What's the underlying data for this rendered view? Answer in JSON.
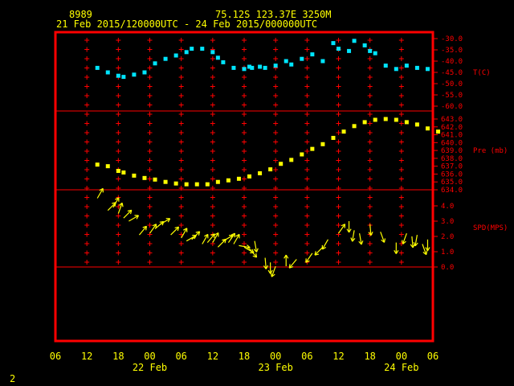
{
  "header": {
    "station_id": "8989",
    "location": "75.12S   123.37E   3250M",
    "time_range": "21 Feb 2015/120000UTC - 24 Feb 2015/000000UTC"
  },
  "footer": {
    "page_number": "2"
  },
  "colors": {
    "frame": "#ff0000",
    "grid": "#ff0000",
    "text": "#ffff00",
    "temperature": "#00e5ff",
    "pressure": "#ffff00",
    "wind": "#ffff00"
  },
  "chart_data": [
    {
      "type": "scatter",
      "panel": "temperature",
      "ylabel": "T(C)",
      "ylim": [
        -60,
        -30
      ],
      "yticks": [
        "-30.0",
        "-35.0",
        "-40.0",
        "-45.0",
        "-50.0",
        "-55.0",
        "-60.0"
      ],
      "y_tick_values": [
        -30,
        -35,
        -40,
        -45,
        -50,
        -55,
        -60
      ],
      "x_hours": [
        14,
        16,
        18,
        19,
        21,
        23,
        25,
        27,
        29,
        31,
        32,
        34,
        36,
        37,
        38,
        40,
        42,
        43,
        43.5,
        45,
        46,
        48,
        50,
        51,
        53,
        55,
        57,
        59,
        60,
        62,
        63,
        65,
        66,
        67,
        69,
        71,
        73,
        75,
        77
      ],
      "values": [
        -43,
        -45,
        -46.5,
        -47,
        -46,
        -45,
        -41,
        -39,
        -37.5,
        -36,
        -34.5,
        -34.5,
        -36,
        -38.5,
        -40.5,
        -43,
        -43.5,
        -42.5,
        -43,
        -42.5,
        -43,
        -42,
        -40,
        -41.5,
        -39,
        -37,
        -40,
        -32,
        -34.5,
        -35.5,
        -31,
        -33,
        -35.5,
        -36.5,
        -42,
        -43.5,
        -42,
        -43,
        -43.5
      ]
    },
    {
      "type": "scatter",
      "panel": "pressure",
      "ylabel": "Pre (mb)",
      "ylim": [
        634,
        643
      ],
      "yticks": [
        "643.0",
        "642.0",
        "641.0",
        "640.0",
        "639.0",
        "638.0",
        "637.0",
        "636.0",
        "635.0",
        "634.0"
      ],
      "y_tick_values": [
        643,
        642,
        641,
        640,
        639,
        638,
        637,
        636,
        635,
        634
      ],
      "x_hours": [
        14,
        16,
        18,
        19,
        21,
        23,
        25,
        27,
        29,
        31,
        33,
        35,
        37,
        39,
        41,
        43,
        45,
        47,
        49,
        51,
        53,
        55,
        57,
        59,
        61,
        63,
        65,
        67,
        69,
        71,
        73,
        75,
        77,
        79
      ],
      "values": [
        637.2,
        637.0,
        636.4,
        636.2,
        635.8,
        635.5,
        635.3,
        635.0,
        634.8,
        634.7,
        634.7,
        634.7,
        635.0,
        635.2,
        635.4,
        635.7,
        636.1,
        636.6,
        637.3,
        637.8,
        638.5,
        639.2,
        639.8,
        640.6,
        641.4,
        642.1,
        642.6,
        642.9,
        643.0,
        642.9,
        642.6,
        642.3,
        641.8,
        641.4
      ]
    },
    {
      "type": "scatter",
      "panel": "wind",
      "ylabel": "SPD(MPS)",
      "ylim": [
        0,
        4
      ],
      "yticks": [
        "4.0",
        "3.0",
        "2.0",
        "1.0",
        "0.0"
      ],
      "y_tick_values": [
        4,
        3,
        2,
        1,
        0
      ],
      "x_hours": [
        14,
        16,
        17,
        18,
        19,
        20,
        22,
        24,
        25,
        26,
        28,
        30,
        31,
        32,
        34,
        35,
        36,
        37,
        38,
        39,
        40,
        41,
        42,
        43,
        44,
        46,
        47,
        48,
        50,
        52,
        55,
        57,
        58,
        60,
        62,
        63,
        64,
        66,
        68,
        71,
        73,
        74,
        75,
        76,
        77
      ],
      "values": [
        4.5,
        3.7,
        3.9,
        3.5,
        3.2,
        3.0,
        2.1,
        2.2,
        2.5,
        2.8,
        2.1,
        1.9,
        1.7,
        1.8,
        1.5,
        1.6,
        1.6,
        1.3,
        1.7,
        1.6,
        1.5,
        1.4,
        1.3,
        1.2,
        1.7,
        0.6,
        0.3,
        0.05,
        0.05,
        0.5,
        0.9,
        1.3,
        1.8,
        2.2,
        3.0,
        2.4,
        2.2,
        2.8,
        2.3,
        1.6,
        2.2,
        2.0,
        2.1,
        1.5,
        1.8
      ],
      "direction_deg": [
        30,
        45,
        30,
        20,
        45,
        60,
        40,
        35,
        50,
        60,
        45,
        30,
        60,
        45,
        30,
        40,
        30,
        45,
        60,
        35,
        30,
        100,
        120,
        140,
        170,
        175,
        180,
        200,
        0,
        220,
        215,
        225,
        210,
        35,
        180,
        190,
        170,
        175,
        160,
        180,
        200,
        175,
        190,
        160,
        180
      ]
    }
  ],
  "x_axis": {
    "hour_labels": [
      "06",
      "12",
      "18",
      "00",
      "06",
      "12",
      "18",
      "00",
      "06",
      "12",
      "18",
      "00",
      "06"
    ],
    "hour_values": [
      6,
      12,
      18,
      24,
      30,
      36,
      42,
      48,
      54,
      60,
      66,
      72,
      78
    ],
    "date_labels": [
      "22 Feb",
      "23 Feb",
      "24 Feb"
    ],
    "date_hour_values": [
      24,
      48,
      72
    ]
  }
}
